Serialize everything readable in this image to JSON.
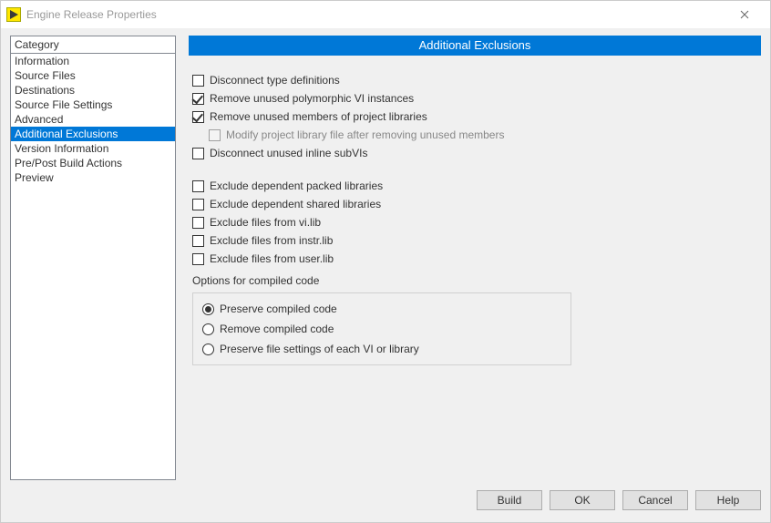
{
  "window": {
    "title": "Engine Release Properties"
  },
  "sidebar": {
    "header": "Category",
    "items": [
      {
        "label": "Information",
        "selected": false
      },
      {
        "label": "Source Files",
        "selected": false
      },
      {
        "label": "Destinations",
        "selected": false
      },
      {
        "label": "Source File Settings",
        "selected": false
      },
      {
        "label": "Advanced",
        "selected": false
      },
      {
        "label": "Additional Exclusions",
        "selected": true
      },
      {
        "label": "Version Information",
        "selected": false
      },
      {
        "label": "Pre/Post Build Actions",
        "selected": false
      },
      {
        "label": "Preview",
        "selected": false
      }
    ]
  },
  "page": {
    "title": "Additional Exclusions",
    "checkboxes": [
      {
        "id": "disconnect-typedefs",
        "label": "Disconnect type definitions",
        "checked": false,
        "indent": 0,
        "disabled": false
      },
      {
        "id": "remove-poly",
        "label": "Remove unused polymorphic VI instances",
        "checked": true,
        "indent": 0,
        "disabled": false
      },
      {
        "id": "remove-members",
        "label": "Remove unused members of project libraries",
        "checked": true,
        "indent": 0,
        "disabled": false
      },
      {
        "id": "modify-lib",
        "label": "Modify project library file after removing unused members",
        "checked": false,
        "indent": 1,
        "disabled": true
      },
      {
        "id": "disconnect-inline",
        "label": "Disconnect unused inline subVIs",
        "checked": false,
        "indent": 0,
        "disabled": false
      }
    ],
    "checkboxes2": [
      {
        "id": "excl-packed",
        "label": "Exclude dependent packed libraries",
        "checked": false
      },
      {
        "id": "excl-shared",
        "label": "Exclude dependent shared libraries",
        "checked": false
      },
      {
        "id": "excl-vilib",
        "label": "Exclude files from vi.lib",
        "checked": false
      },
      {
        "id": "excl-instrlib",
        "label": "Exclude files from instr.lib",
        "checked": false
      },
      {
        "id": "excl-userlib",
        "label": "Exclude files from user.lib",
        "checked": false
      }
    ],
    "radio_section_label": "Options for compiled code",
    "radios": [
      {
        "id": "preserve",
        "label": "Preserve compiled code",
        "selected": true
      },
      {
        "id": "remove",
        "label": "Remove compiled code",
        "selected": false
      },
      {
        "id": "preserve-file",
        "label": "Preserve file settings of each VI or library",
        "selected": false
      }
    ]
  },
  "footer": {
    "build": "Build",
    "ok": "OK",
    "cancel": "Cancel",
    "help": "Help"
  }
}
